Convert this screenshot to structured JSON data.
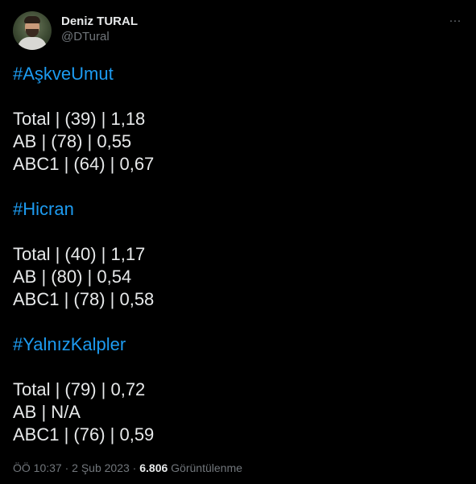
{
  "author": {
    "display_name": "Deniz TURAL",
    "handle": "@DTural"
  },
  "more_button": {
    "icon": "more-dots-icon",
    "glyph": "···"
  },
  "sections": [
    {
      "hashtag": "#AşkveUmut",
      "rows": [
        "Total | (39) | 1,18",
        "AB | (78) | 0,55",
        "ABC1 | (64) | 0,67"
      ]
    },
    {
      "hashtag": "#Hicran",
      "rows": [
        "Total | (40) | 1,17",
        "AB | (80) | 0,54",
        "ABC1 | (78) | 0,58"
      ]
    },
    {
      "hashtag": "#YalnızKalpler",
      "rows": [
        "Total | (79) | 0,72",
        "AB | N/A",
        "ABC1 | (76) | 0,59"
      ]
    }
  ],
  "meta": {
    "time": "ÖÖ 10:37",
    "separator": " · ",
    "date": "2 Şub 2023",
    "views_count": "6.806",
    "views_label": "Görüntülenme"
  },
  "colors": {
    "background": "#000000",
    "text": "#e7e9ea",
    "secondary": "#71767b",
    "hashtag": "#1d9bf0"
  }
}
